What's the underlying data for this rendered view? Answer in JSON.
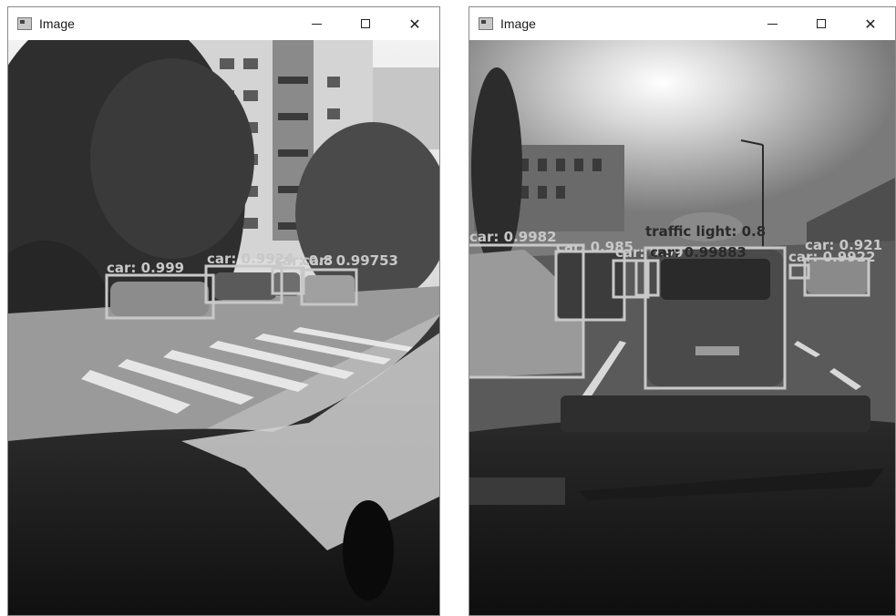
{
  "windows": [
    {
      "title": "Image",
      "controls": {
        "minimize": "minimize-icon",
        "maximize": "maximize-icon",
        "close": "close-icon"
      },
      "detections": [
        {
          "label": "car: 0.999"
        },
        {
          "label": "car: 0.9924"
        },
        {
          "label": "car: 0.8"
        },
        {
          "label": "car: 0.99753"
        }
      ]
    },
    {
      "title": "Image",
      "controls": {
        "minimize": "minimize-icon",
        "maximize": "maximize-icon",
        "close": "close-icon"
      },
      "detections": [
        {
          "label": "car: 0.9982"
        },
        {
          "label": "car: 0.985"
        },
        {
          "label": "car: 0.99"
        },
        {
          "label": "traffic light: 0.8"
        },
        {
          "label": "car: 0.99883"
        },
        {
          "label": "car: 0.921"
        },
        {
          "label": "car: 0.9922"
        }
      ]
    }
  ],
  "colors": {
    "box": "#c8c8c8",
    "label_dark": "#2a2a2a"
  }
}
